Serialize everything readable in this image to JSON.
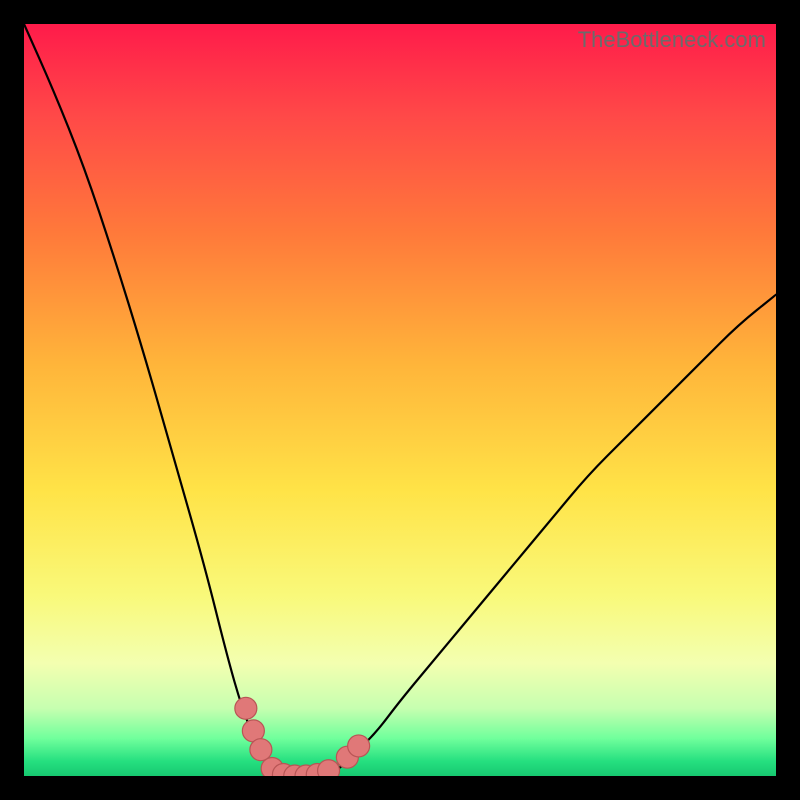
{
  "watermark": "TheBottleneck.com",
  "chart_data": {
    "type": "line",
    "title": "",
    "xlabel": "",
    "ylabel": "",
    "xlim": [
      0,
      100
    ],
    "ylim": [
      0,
      100
    ],
    "series": [
      {
        "name": "left-curve",
        "x": [
          0,
          4,
          8,
          12,
          16,
          20,
          24,
          27,
          29,
          31,
          33,
          35,
          36
        ],
        "values": [
          100,
          91,
          81,
          69,
          56,
          42,
          28,
          16,
          9,
          4,
          1,
          0,
          0
        ]
      },
      {
        "name": "right-curve",
        "x": [
          38,
          40,
          42,
          44,
          47,
          50,
          55,
          60,
          65,
          70,
          75,
          80,
          85,
          90,
          95,
          100
        ],
        "values": [
          0,
          0,
          1,
          3,
          6,
          10,
          16,
          22,
          28,
          34,
          40,
          45,
          50,
          55,
          60,
          64
        ]
      }
    ],
    "markers": [
      {
        "id": "m1",
        "x": 29.5,
        "y": 9.0
      },
      {
        "id": "m2",
        "x": 30.5,
        "y": 6.0
      },
      {
        "id": "m3",
        "x": 31.5,
        "y": 3.5
      },
      {
        "id": "m4",
        "x": 33.0,
        "y": 1.0
      },
      {
        "id": "m5",
        "x": 34.5,
        "y": 0.2
      },
      {
        "id": "m6",
        "x": 36.0,
        "y": 0.0
      },
      {
        "id": "m7",
        "x": 37.5,
        "y": 0.0
      },
      {
        "id": "m8",
        "x": 39.0,
        "y": 0.2
      },
      {
        "id": "m9",
        "x": 40.5,
        "y": 0.7
      },
      {
        "id": "m10",
        "x": 43.0,
        "y": 2.5
      },
      {
        "id": "m11",
        "x": 44.5,
        "y": 4.0
      }
    ],
    "marker_style": {
      "r_outer": 11,
      "r_inner": 7,
      "fill": "#e07878",
      "stroke": "#b85555"
    }
  }
}
